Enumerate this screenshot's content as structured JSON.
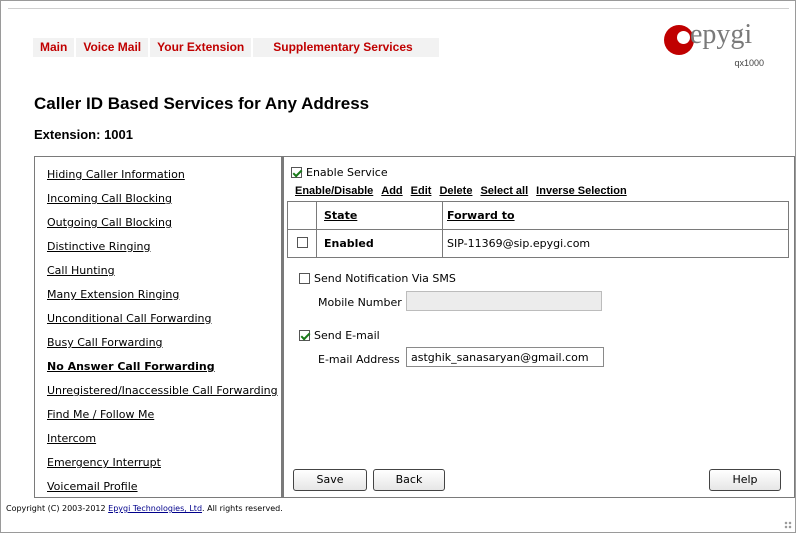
{
  "nav": {
    "items": [
      "Main",
      "Voice Mail",
      "Your Extension",
      "Supplementary Services"
    ]
  },
  "logo": {
    "brand": "epygi",
    "model": "qx1000"
  },
  "page": {
    "title": "Caller ID Based Services for Any Address",
    "extension_label": "Extension: 1001"
  },
  "sidebar": {
    "items": [
      "Hiding Caller Information",
      "Incoming Call Blocking",
      "Outgoing Call Blocking",
      "Distinctive Ringing",
      "Call Hunting",
      "Many Extension Ringing",
      "Unconditional Call Forwarding",
      "Busy Call Forwarding",
      "No Answer Call Forwarding",
      "Unregistered/Inaccessible Call Forwarding",
      "Find Me / Follow Me",
      "Intercom",
      "Emergency Interrupt",
      "Voicemail Profile"
    ],
    "active": "No Answer Call Forwarding"
  },
  "service": {
    "enable_label": "Enable Service",
    "enabled": true,
    "actions": [
      "Enable/Disable",
      "Add",
      "Edit",
      "Delete",
      "Select all",
      "Inverse Selection"
    ]
  },
  "table": {
    "headers": [
      "State",
      "Forward to"
    ],
    "rows": [
      {
        "selected": false,
        "state": "Enabled",
        "forward_to": "SIP-11369@sip.epygi.com"
      }
    ]
  },
  "sms": {
    "label": "Send Notification Via SMS",
    "checked": false,
    "mobile_label": "Mobile Number",
    "mobile_value": ""
  },
  "email": {
    "label": "Send E-mail",
    "checked": true,
    "address_label": "E-mail Address",
    "address_value": "astghik_sanasaryan@gmail.com"
  },
  "buttons": {
    "save": "Save",
    "back": "Back",
    "help": "Help"
  },
  "footer": {
    "prefix": "Copyright (C) 2003-2012 ",
    "company": "Epygi Technologies, Ltd",
    "suffix": ". All rights reserved."
  },
  "colors": {
    "nav_text": "#c00000",
    "nav_bg": "#f2f2f2",
    "check": "#1a7a1a",
    "logo": "#c00000"
  }
}
